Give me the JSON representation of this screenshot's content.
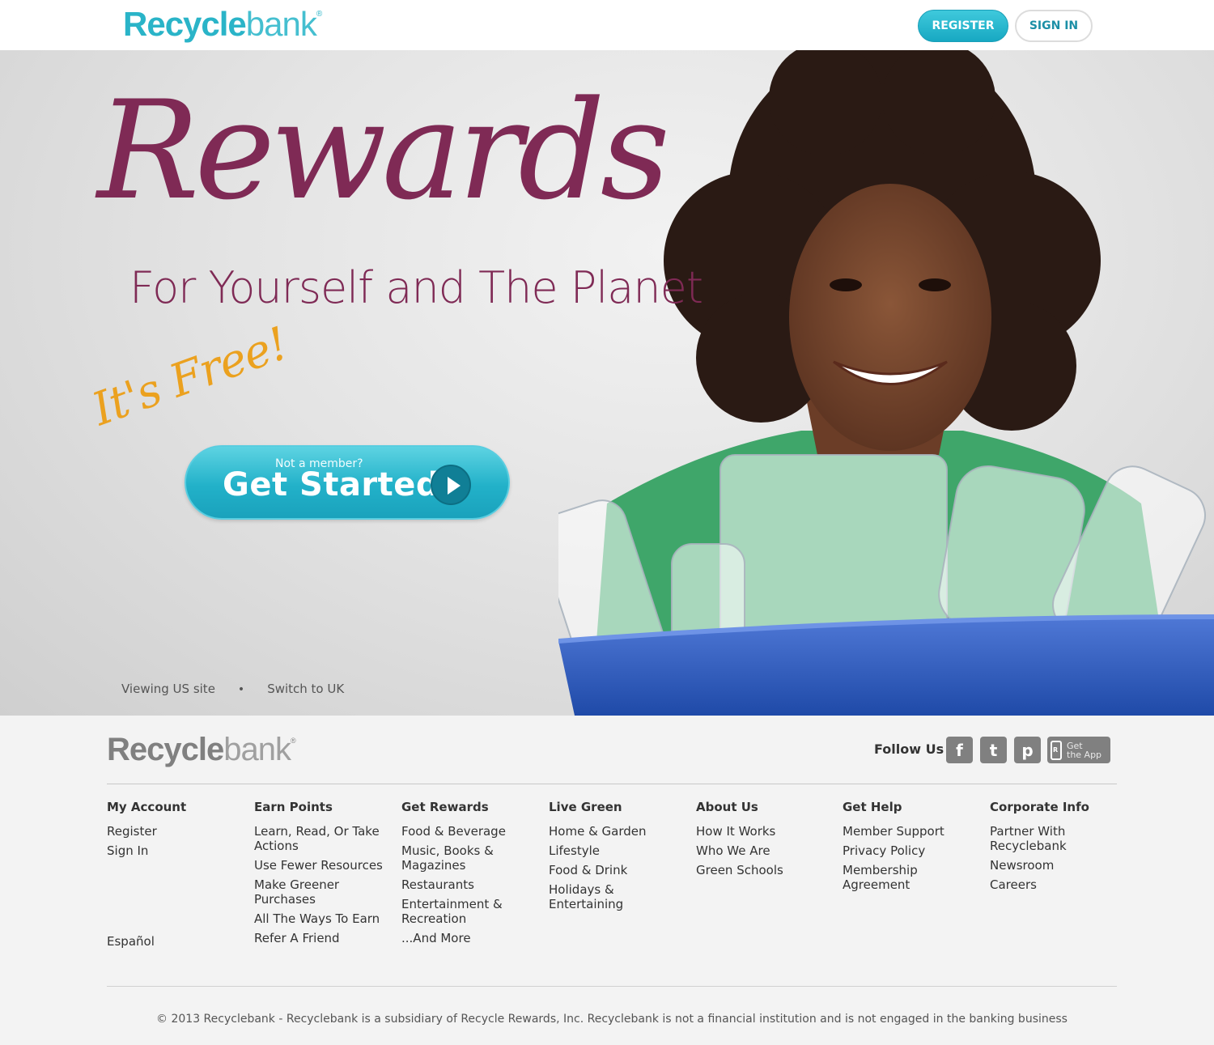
{
  "header": {
    "logo_bold": "Recycle",
    "logo_thin": "bank",
    "logo_mark": "®",
    "register_label": "REGISTER",
    "signin_label": "SIGN IN"
  },
  "hero": {
    "title": "Rewards",
    "subtitle": "For Yourself and The Planet",
    "free_tag": "It's Free!",
    "cta_small": "Not a member?",
    "cta_big": "Get Started",
    "site_current": "Viewing US site",
    "site_separator": "•",
    "site_switch": "Switch to UK"
  },
  "footer": {
    "logo_bold": "Recycle",
    "logo_thin": "bank",
    "logo_mark": "®",
    "follow_label": "Follow Us",
    "social": {
      "facebook": "f",
      "twitter": "t",
      "pinterest": "p",
      "app_line1": "Get",
      "app_line2": "the App"
    },
    "columns": [
      {
        "heading": "My Account",
        "items": [
          "Register",
          "Sign In"
        ]
      },
      {
        "heading": "Earn Points",
        "items": [
          "Learn, Read, Or Take Actions",
          "Use Fewer Resources",
          "Make Greener Purchases",
          "All The Ways To Earn",
          "Refer A Friend"
        ]
      },
      {
        "heading": "Get Rewards",
        "items": [
          "Food & Beverage",
          "Music, Books & Magazines",
          "Restaurants",
          "Entertainment & Recreation",
          "...And More"
        ]
      },
      {
        "heading": "Live Green",
        "items": [
          "Home & Garden",
          "Lifestyle",
          "Food & Drink",
          "Holidays & Entertaining"
        ]
      },
      {
        "heading": "About Us",
        "items": [
          "How It Works",
          "Who We Are",
          "Green Schools"
        ]
      },
      {
        "heading": "Get Help",
        "items": [
          "Member Support",
          "Privacy Policy",
          "Membership Agreement"
        ]
      },
      {
        "heading": "Corporate Info",
        "items": [
          "Partner With Recyclebank",
          "Newsroom",
          "Careers"
        ]
      }
    ],
    "language": "Español",
    "copyright": "© 2013 Recyclebank - Recyclebank is a subsidiary of Recycle Rewards, Inc. Recyclebank is not a financial institution and is not engaged in the banking business"
  },
  "colors": {
    "brand_teal": "#2ab4c8",
    "title_plum": "#7f2a55",
    "free_orange": "#eba11f",
    "social_gray": "#808080"
  }
}
